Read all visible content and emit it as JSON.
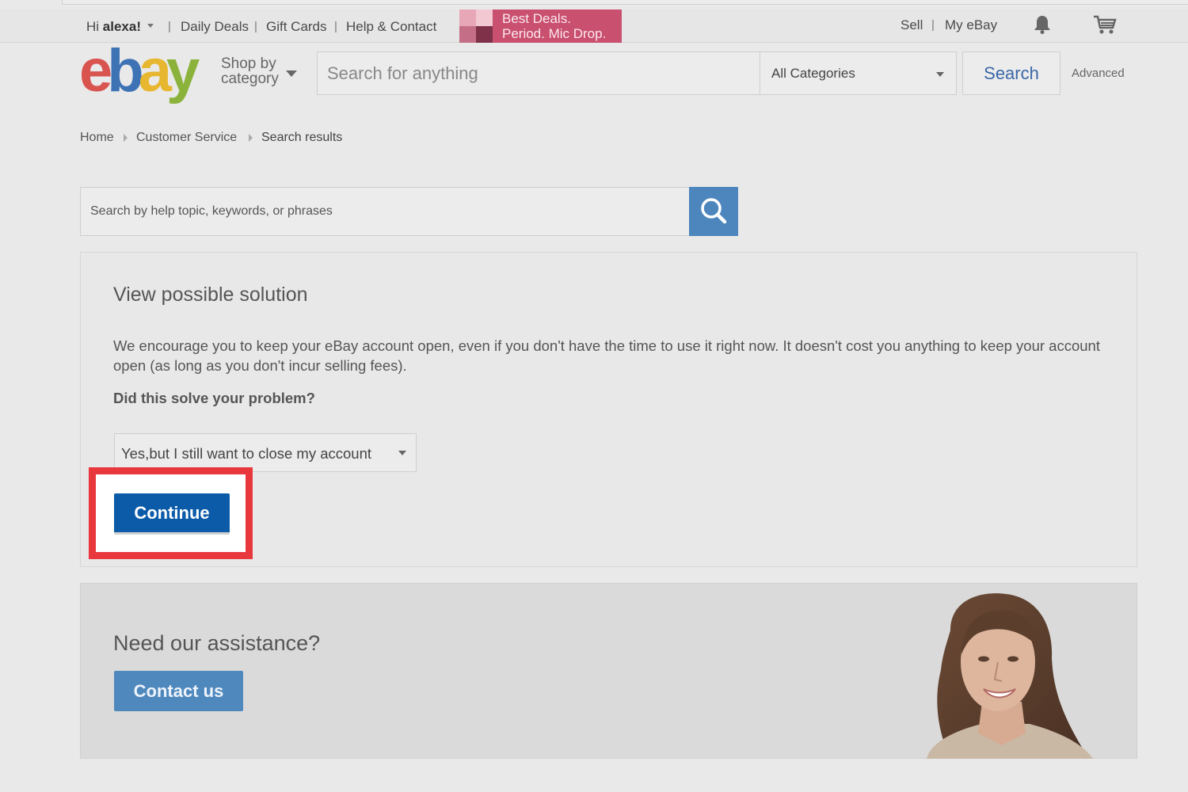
{
  "topbar": {
    "greeting_prefix": "Hi",
    "username": "alexa!",
    "links": [
      "Daily Deals",
      "Gift Cards",
      "Help & Contact"
    ],
    "separator": "|",
    "promo_line1": "Best Deals.",
    "promo_line2": "Period. Mic Drop.",
    "promo_color": "#c9506f",
    "sell": "Sell",
    "my_ebay": "My eBay",
    "bell_icon": "bell-icon",
    "cart_icon": "cart-icon"
  },
  "header": {
    "logo": {
      "e": "e",
      "b": "b",
      "a": "a",
      "y": "y"
    },
    "shop_by_line1": "Shop by",
    "shop_by_line2": "category",
    "search_placeholder": "Search for anything",
    "category_selected": "All Categories",
    "search_label": "Search",
    "advanced_label": "Advanced"
  },
  "breadcrumb": [
    "Home",
    "Customer Service",
    "Search results"
  ],
  "help_search": {
    "placeholder": "Search by help topic, keywords, or phrases",
    "button_color": "#4c86bd"
  },
  "solution": {
    "title": "View possible solution",
    "text": "We encourage you to keep your eBay account open, even if you don't have the time to use it right now. It doesn't cost you anything to keep your account open (as long as you don't incur selling fees).",
    "question": "Did this solve your problem?",
    "answer_selected": "Yes,but I still want to close my account",
    "continue_label": "Continue",
    "highlight_color": "#e8383d"
  },
  "assistance": {
    "title": "Need our assistance?",
    "contact_label": "Contact us"
  }
}
